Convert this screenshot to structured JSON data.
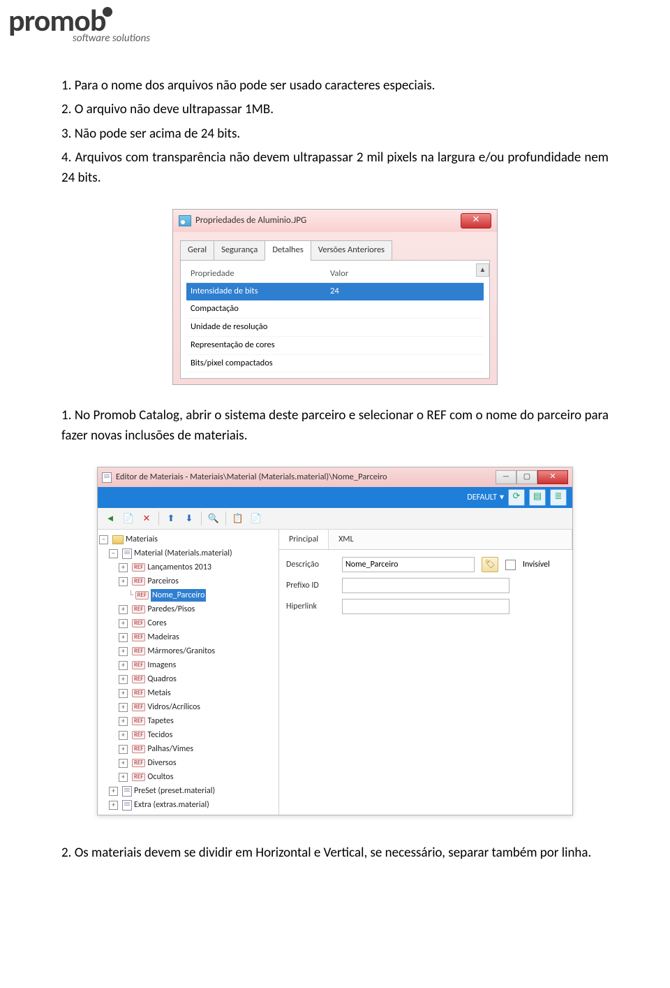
{
  "logo": {
    "brand": "promob",
    "sub": "software solutions"
  },
  "body": {
    "p1": "1. Para o nome dos arquivos não pode ser usado caracteres especiais.",
    "p2": "2. O arquivo não deve ultrapassar 1MB.",
    "p3": "3. Não pode ser acima de 24 bits.",
    "p4": "4. Arquivos com transparência não devem ultrapassar 2 mil pixels na largura e/ou profundidade nem 24 bits.",
    "p5": "1. No Promob Catalog, abrir o sistema deste parceiro e selecionar o REF com o nome do parceiro para fazer novas inclusões de materiais.",
    "p6": "2. Os materiais devem se dividir em Horizontal e Vertical, se necessário, separar também por linha."
  },
  "win1": {
    "title": "Propriedades de Aluminio.JPG",
    "tabs": [
      "Geral",
      "Segurança",
      "Detalhes",
      "Versões Anteriores"
    ],
    "header": {
      "prop": "Propriedade",
      "val": "Valor"
    },
    "rows": [
      {
        "prop": "Intensidade de bits",
        "val": "24",
        "selected": true
      },
      {
        "prop": "Compactação",
        "val": ""
      },
      {
        "prop": "Unidade de resolução",
        "val": ""
      },
      {
        "prop": "Representação de cores",
        "val": ""
      },
      {
        "prop": "Bits/pixel compactados",
        "val": ""
      }
    ]
  },
  "win2": {
    "title": "Editor de Materiais - Materiais\\Material (Materials.material)\\Nome_Parceiro",
    "default_label": "DEFAULT",
    "tabs": [
      "Principal",
      "XML"
    ],
    "form": {
      "desc_label": "Descrição",
      "desc_value": "Nome_Parceiro",
      "invisivel_label": "Invisível",
      "prefix_label": "Prefixo ID",
      "prefix_value": "",
      "link_label": "Hiperlink",
      "link_value": ""
    },
    "tree": {
      "root": "Materiais",
      "material_node": "Material (Materials.material)",
      "refs": [
        "Lançamentos 2013",
        "Parceiros",
        "Nome_Parceiro",
        "Paredes/Pisos",
        "Cores",
        "Madeiras",
        "Mármores/Granitos",
        "Imagens",
        "Quadros",
        "Metais",
        "Vidros/Acrílicos",
        "Tapetes",
        "Tecidos",
        "Palhas/Vimes",
        "Diversos",
        "Ocultos"
      ],
      "preset": "PreSet (preset.material)",
      "extra": "Extra (extras.material)"
    }
  }
}
